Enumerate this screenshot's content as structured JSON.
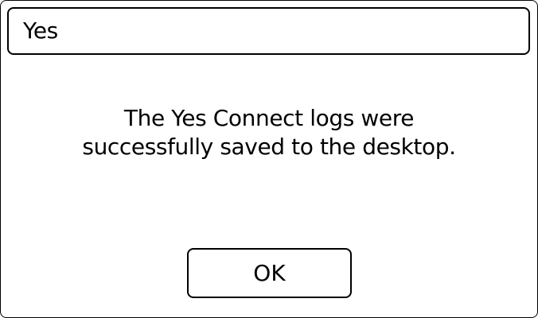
{
  "dialog": {
    "title": "Yes",
    "message": "The Yes Connect logs were\nsuccessfully saved to the desktop.",
    "ok_label": "OK"
  }
}
